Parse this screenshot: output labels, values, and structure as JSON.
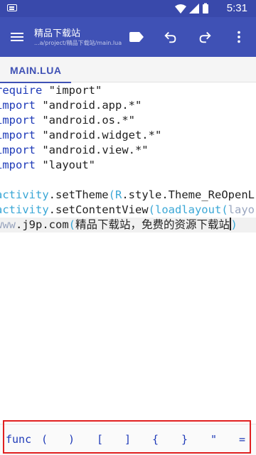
{
  "status_bar": {
    "time": "5:31",
    "icons": [
      "keyboard-icon",
      "wifi-icon",
      "signal-icon",
      "battery-icon"
    ]
  },
  "toolbar": {
    "title": "精品下载站",
    "path": "...a/project/精品下载站/main.lua",
    "actions": [
      "run-icon",
      "undo-icon",
      "redo-icon",
      "more-vert-icon"
    ]
  },
  "tabs": [
    {
      "label": "MAIN.LUA",
      "active": true
    }
  ],
  "editor": {
    "lines": [
      [
        {
          "t": "require",
          "c": "kw"
        },
        {
          "t": " \"import\"",
          "c": "str"
        }
      ],
      [
        {
          "t": "import",
          "c": "kw"
        },
        {
          "t": " \"android.app.*\"",
          "c": "str"
        }
      ],
      [
        {
          "t": "import",
          "c": "kw"
        },
        {
          "t": " \"android.os.*\"",
          "c": "str"
        }
      ],
      [
        {
          "t": "import",
          "c": "kw"
        },
        {
          "t": " \"android.widget.*\"",
          "c": "str"
        }
      ],
      [
        {
          "t": "import",
          "c": "kw"
        },
        {
          "t": " \"android.view.*\"",
          "c": "str"
        }
      ],
      [
        {
          "t": "import",
          "c": "kw"
        },
        {
          "t": " \"layout\"",
          "c": "str"
        }
      ],
      [],
      [
        {
          "t": "activity",
          "c": "obj"
        },
        {
          "t": ".setTheme",
          "c": "fn"
        },
        {
          "t": "(",
          "c": "paren"
        },
        {
          "t": "R",
          "c": "obj"
        },
        {
          "t": ".style.Theme_ReOpenL",
          "c": "fn"
        }
      ],
      [
        {
          "t": "activity",
          "c": "obj"
        },
        {
          "t": ".setContentView",
          "c": "fn"
        },
        {
          "t": "(",
          "c": "paren"
        },
        {
          "t": "loadlayout",
          "c": "obj"
        },
        {
          "t": "(",
          "c": "paren"
        },
        {
          "t": "layo",
          "c": "dim"
        }
      ],
      [
        {
          "t": "www",
          "c": "dim"
        },
        {
          "t": ".j9p.com",
          "c": "fn"
        },
        {
          "t": "(",
          "c": "paren"
        },
        {
          "t": "精品下载站，免费的资源下载站",
          "c": "fn"
        },
        {
          "t": "|",
          "c": "cursor"
        },
        {
          "t": ")",
          "c": "paren"
        }
      ]
    ]
  },
  "symbol_bar": {
    "symbols": [
      "func",
      "(",
      ")",
      "[",
      "]",
      "{",
      "}",
      "\"",
      "="
    ]
  },
  "colors": {
    "primary": "#3f51b5",
    "primary_dark": "#3949ab",
    "keyword": "#1e3ab8",
    "object": "#3aa7d6",
    "annotation": "#e02020"
  }
}
